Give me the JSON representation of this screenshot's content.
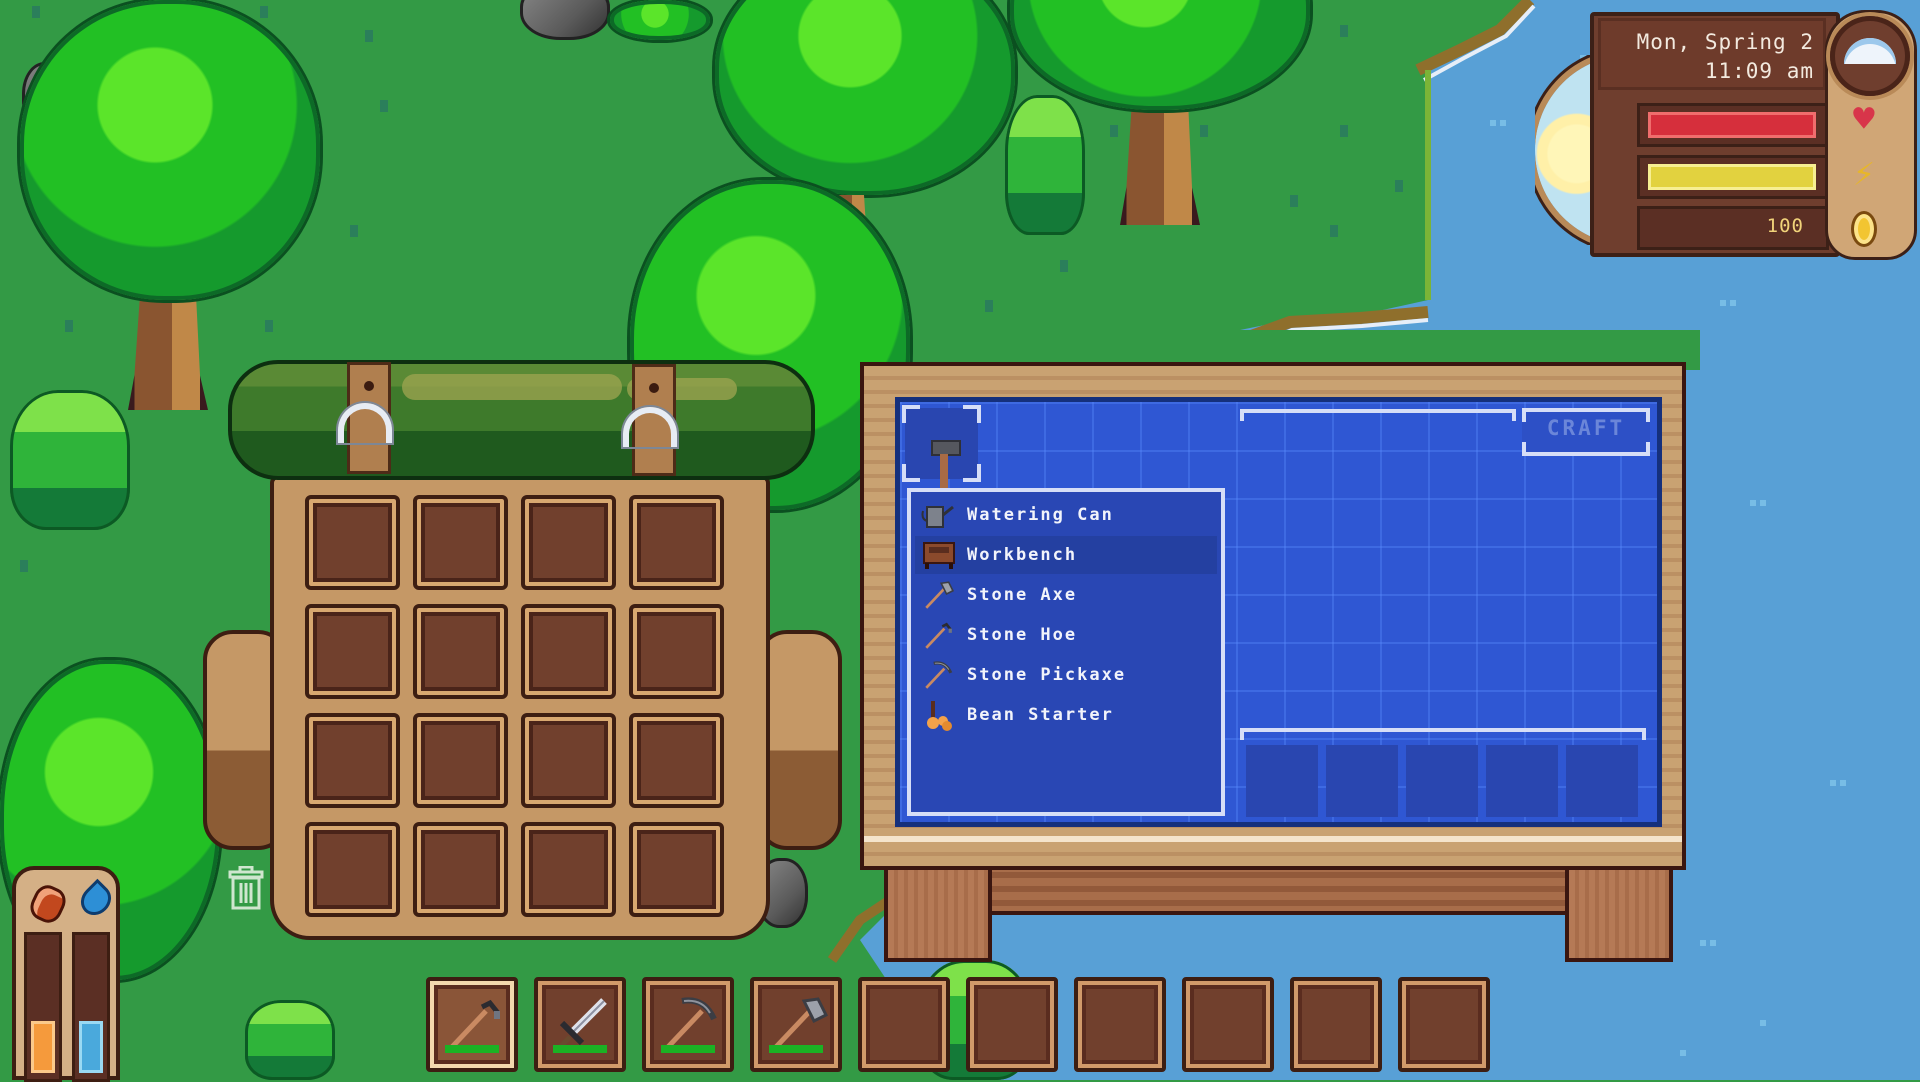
{
  "hud": {
    "date": "Mon, Spring 2",
    "time": "11:09 am",
    "weather_icon": "cloud-icon",
    "health": {
      "icon": "heart-icon",
      "fraction": 1.0,
      "color": "#d62f3c"
    },
    "energy": {
      "icon": "lightning-icon",
      "fraction": 1.0,
      "color": "#e2d23f"
    },
    "gold": {
      "icon": "coin-icon",
      "amount": "100"
    },
    "colors": {
      "frame": "#6f3e2e",
      "text": "#f3eadf",
      "gold_text": "#f1d37a"
    }
  },
  "needs": {
    "hunger": {
      "icon": "meat-icon",
      "fraction": 0.4,
      "color": "#f59a3c"
    },
    "thirst": {
      "icon": "water-drop-icon",
      "fraction": 0.4,
      "color": "#4aa9dc"
    }
  },
  "inventory": {
    "rows": 4,
    "cols": 4,
    "slots": [
      "",
      "",
      "",
      "",
      "",
      "",
      "",
      "",
      "",
      "",
      "",
      "",
      "",
      "",
      "",
      ""
    ],
    "trash_icon": "trash-icon"
  },
  "crafting": {
    "selected_item_icon": "hammer-icon",
    "selected_title": "",
    "craft_button": "Craft",
    "recipes": [
      {
        "label": "Watering Can",
        "icon": "watering-can-icon",
        "selected": false
      },
      {
        "label": "Workbench",
        "icon": "workbench-icon",
        "selected": true
      },
      {
        "label": "Stone Axe",
        "icon": "axe-icon",
        "selected": false
      },
      {
        "label": "Stone Hoe",
        "icon": "hoe-icon",
        "selected": false
      },
      {
        "label": "Stone Pickaxe",
        "icon": "pickaxe-icon",
        "selected": false
      },
      {
        "label": "Bean Starter",
        "icon": "bean-starter-icon",
        "selected": false
      }
    ],
    "ingredient_slots": [
      "",
      "",
      "",
      "",
      ""
    ],
    "colors": {
      "blueprint": "#2f57d3",
      "text": "#f2f4fb",
      "craft_disabled": "#6b86d9"
    }
  },
  "hotbar": {
    "selected_index": 0,
    "slots": [
      {
        "item": "Stone Hoe",
        "icon": "hoe-icon",
        "durability": 1.0
      },
      {
        "item": "Sword",
        "icon": "sword-icon",
        "durability": 1.0
      },
      {
        "item": "Stone Pickaxe",
        "icon": "pickaxe-icon",
        "durability": 1.0
      },
      {
        "item": "Stone Axe",
        "icon": "axe-icon",
        "durability": 1.0
      },
      {
        "item": "",
        "icon": "",
        "durability": null
      },
      {
        "item": "",
        "icon": "",
        "durability": null
      },
      {
        "item": "",
        "icon": "",
        "durability": null
      },
      {
        "item": "",
        "icon": "",
        "durability": null
      },
      {
        "item": "",
        "icon": "",
        "durability": null
      },
      {
        "item": "",
        "icon": "",
        "durability": null
      }
    ]
  }
}
